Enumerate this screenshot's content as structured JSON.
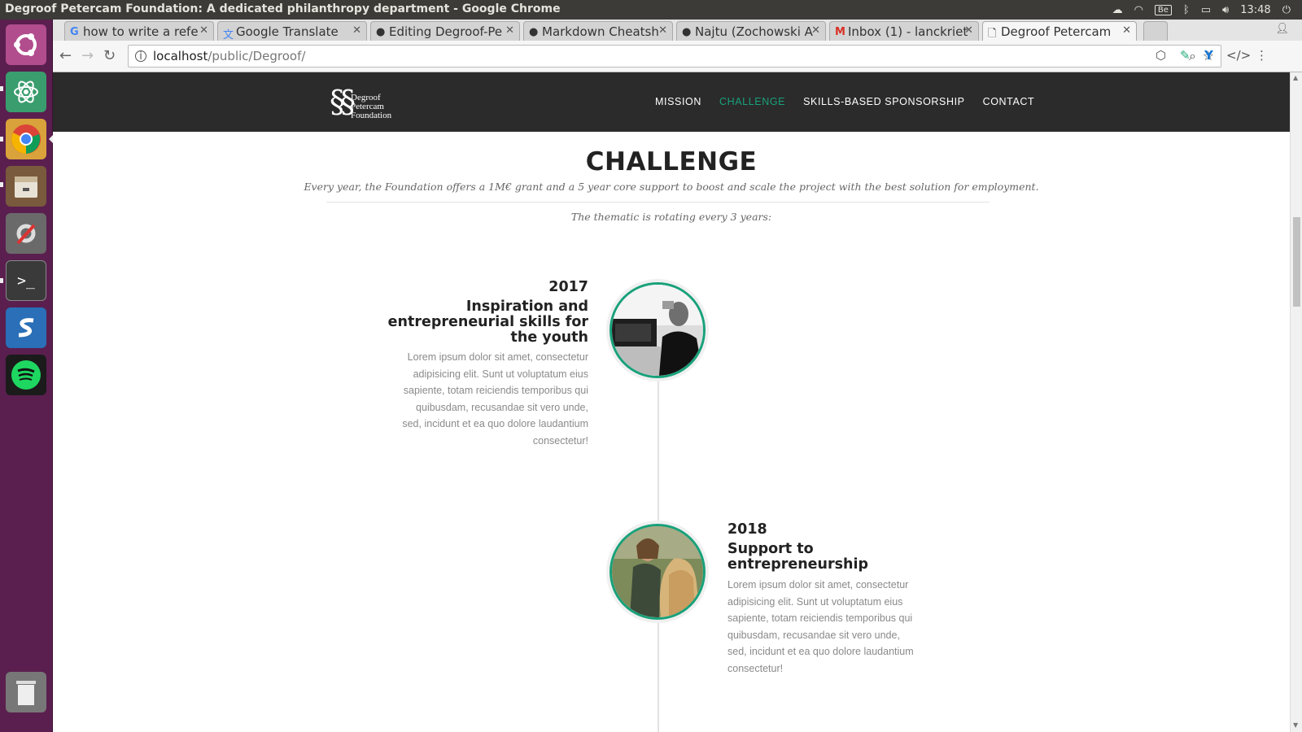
{
  "os": {
    "window_title": "Degroof Petercam Foundation: A dedicated philanthropy department - Google Chrome",
    "keyboard_layout": "Be",
    "clock": "13:48"
  },
  "browser": {
    "tabs": [
      {
        "label": "how to write a refe",
        "favicon": "google-icon"
      },
      {
        "label": "Google Translate",
        "favicon": "translate-icon"
      },
      {
        "label": "Editing Degroof-Pe",
        "favicon": "github-icon"
      },
      {
        "label": "Markdown Cheatsh",
        "favicon": "github-icon"
      },
      {
        "label": "Najtu (Zochowski A",
        "favicon": "github-icon"
      },
      {
        "label": "Inbox (1) - lanckriet",
        "favicon": "gmail-icon"
      },
      {
        "label": "Degroof Petercam",
        "favicon": "page-icon",
        "active": true
      }
    ],
    "url_host": "localhost",
    "url_path": "/public/Degroof/"
  },
  "site": {
    "logo_lines": [
      "Degroof",
      "Petercam",
      "Foundation"
    ],
    "nav": [
      {
        "label": "MISSION"
      },
      {
        "label": "CHALLENGE",
        "active": true
      },
      {
        "label": "SKILLS-BASED SPONSORSHIP"
      },
      {
        "label": "CONTACT"
      }
    ],
    "accent_color": "#18a17a"
  },
  "challenge": {
    "title": "CHALLENGE",
    "intro": "Every year, the Foundation offers a 1M€ grant and a 5 year core support to boost and scale the project with the best solution for employment.",
    "rotation": "The thematic is rotating every 3 years:",
    "timeline": [
      {
        "year": "2017",
        "heading": "Inspiration and entrepreneurial skills for the youth",
        "body": "Lorem ipsum dolor sit amet, consectetur adipisicing elit. Sunt ut voluptatum eius sapiente, totam reiciendis temporibus qui quibusdam, recusandae sit vero unde, sed, incidunt et ea quo dolore laudantium consectetur!"
      },
      {
        "year": "2018",
        "heading": "Support to entrepreneurship",
        "body": "Lorem ipsum dolor sit amet, consectetur adipisicing elit. Sunt ut voluptatum eius sapiente, totam reiciendis temporibus qui quibusdam, recusandae sit vero unde, sed, incidunt et ea quo dolore laudantium consectetur!"
      }
    ]
  }
}
